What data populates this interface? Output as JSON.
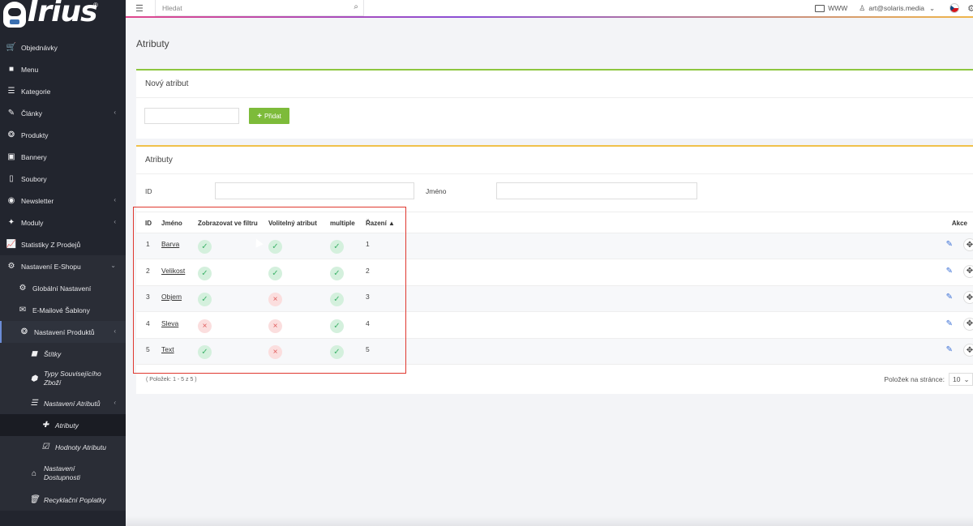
{
  "brand": {
    "name": "Irius",
    "reg": "®"
  },
  "sidebar": {
    "items": [
      {
        "label": "Objednávky",
        "icon": "cart-icon"
      },
      {
        "label": "Menu",
        "icon": "folder-icon"
      },
      {
        "label": "Kategorie",
        "icon": "list-icon"
      },
      {
        "label": "Články",
        "icon": "pen-icon"
      },
      {
        "label": "Produkty",
        "icon": "box-icon"
      },
      {
        "label": "Bannery",
        "icon": "image-icon"
      },
      {
        "label": "Soubory",
        "icon": "file-icon"
      },
      {
        "label": "Newsletter",
        "icon": "newsletter-icon"
      },
      {
        "label": "Moduly",
        "icon": "module-icon"
      },
      {
        "label": "Statistiky Z Prodejů",
        "icon": "chart-icon"
      },
      {
        "label": "Nastavení E-Shopu",
        "icon": "settings-icon"
      },
      {
        "label": "Globální Nastavení",
        "icon": "gear-icon"
      },
      {
        "label": "E-Mailové Šablony",
        "icon": "mail-icon"
      },
      {
        "label": "Nastavení Produktů",
        "icon": "product-settings-icon"
      },
      {
        "label": "Štítky",
        "icon": "tag-icon"
      },
      {
        "label": "Typy Souvisejícího Zboží",
        "icon": "cube-icon"
      },
      {
        "label": "Nastavení Atributů",
        "icon": "sliders-icon"
      },
      {
        "label": "Atributy",
        "icon": "plus-icon"
      },
      {
        "label": "Hodnoty Atributu",
        "icon": "checkbox-icon"
      },
      {
        "label": "Nastavení Dostupnosti",
        "icon": "home-icon"
      },
      {
        "label": "Recyklační Poplatky",
        "icon": "trash-icon"
      }
    ]
  },
  "topbar": {
    "search_placeholder": "Hledat",
    "www_label": "WWW",
    "user_email": "art@solaris.media"
  },
  "page": {
    "title": "Atributy"
  },
  "new_attribute": {
    "title": "Nový atribut",
    "add_label": "Přidat",
    "input_value": ""
  },
  "attributes": {
    "title": "Atributy",
    "filter_id_label": "ID",
    "filter_name_label": "Jméno",
    "columns": {
      "id": "ID",
      "name": "Jméno",
      "show_in_filter": "Zobrazovat ve filtru",
      "optional": "Volitelný atribut",
      "multiple": "multiple",
      "order": "Řazení",
      "actions": "Akce"
    },
    "rows": [
      {
        "id": "1",
        "name": "Barva",
        "show_in_filter": true,
        "optional": true,
        "multiple": true,
        "order": "1"
      },
      {
        "id": "2",
        "name": "Velikost",
        "show_in_filter": true,
        "optional": true,
        "multiple": true,
        "order": "2"
      },
      {
        "id": "3",
        "name": "Objem",
        "show_in_filter": true,
        "optional": false,
        "multiple": true,
        "order": "3"
      },
      {
        "id": "4",
        "name": "Sleva",
        "show_in_filter": false,
        "optional": false,
        "multiple": true,
        "order": "4"
      },
      {
        "id": "5",
        "name": "Text",
        "show_in_filter": true,
        "optional": false,
        "multiple": true,
        "order": "5"
      }
    ],
    "items_info": "( Položek: 1 - 5 z 5 )",
    "per_page_label": "Položek na stránce:",
    "per_page_value": "10"
  },
  "colors": {
    "sidebar_bg": "#22252e",
    "accent_green": "#8dc63f",
    "accent_yellow": "#f0c14b",
    "highlight_red": "#e0382f"
  }
}
